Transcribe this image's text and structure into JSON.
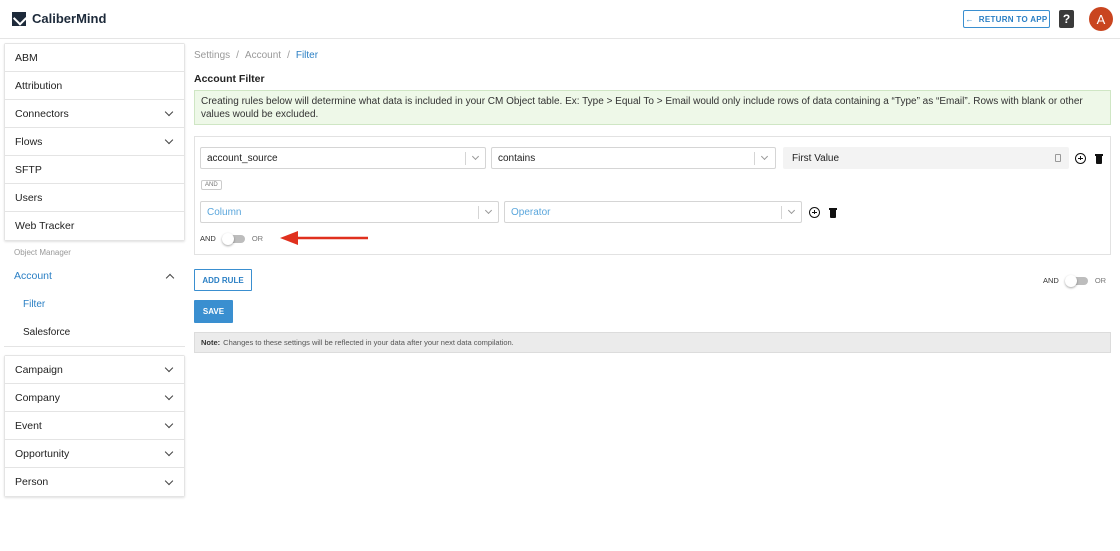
{
  "header": {
    "app_name": "CaliberMind",
    "return_label": "RETURN TO APP",
    "help_glyph": "?",
    "avatar_initial": "A",
    "colors": {
      "brand": "#1d2a3a",
      "accent": "#2a7fc4",
      "avatar": "#c9451f"
    }
  },
  "sidebar": {
    "top_items": [
      "ABM",
      "Attribution",
      "Connectors",
      "Flows",
      "SFTP",
      "Users",
      "Web Tracker"
    ],
    "section_label": "Object Manager",
    "account": {
      "label": "Account",
      "children": [
        "Filter",
        "Salesforce"
      ]
    },
    "bottom_items": [
      "Campaign",
      "Company",
      "Event",
      "Opportunity",
      "Person"
    ]
  },
  "breadcrumb": [
    "Settings",
    "Account",
    "Filter"
  ],
  "page_title": "Account Filter",
  "info_text": "Creating rules below will determine what data is included in your CM Object table. Ex: Type > Equal To > Email would only include rows of data containing a “Type” as “Email”. Rows with blank or other values would be excluded.",
  "rule": {
    "column_value": "account_source",
    "operator_value": "contains",
    "value_text": "First Value",
    "and_chip": "AND",
    "column_placeholder": "Column",
    "operator_placeholder": "Operator",
    "toggle_and": "AND",
    "toggle_or": "OR"
  },
  "actions": {
    "add_rule": "ADD RULE",
    "save": "SAVE",
    "global_toggle_and": "AND",
    "global_toggle_or": "OR"
  },
  "note": {
    "label": "Note:",
    "text": "Changes to these settings will be reflected in your data after your next data compilation."
  },
  "annotation_color": "#e0301e"
}
